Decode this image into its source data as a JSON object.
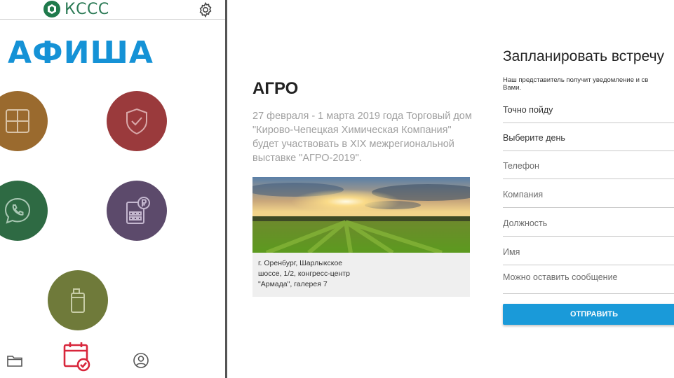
{
  "app": {
    "logo_text": "КССС",
    "section_title": "АФИША"
  },
  "tiles": [
    {
      "icon": "grid-icon",
      "color": "#9a6a2e"
    },
    {
      "icon": "shield-check-icon",
      "color": "#9a3a3c"
    },
    {
      "icon": "phone-chat-icon",
      "color": "#2e6a43"
    },
    {
      "icon": "calculator-ruble-icon",
      "color": "#5c4a6b"
    },
    {
      "icon": "canister-icon",
      "color": "#6f7a3a"
    }
  ],
  "bottom_nav": [
    {
      "icon": "folder-icon"
    },
    {
      "icon": "calendar-check-icon",
      "color": "#d8263b"
    },
    {
      "icon": "profile-icon"
    }
  ],
  "event": {
    "title": "АГРО",
    "description": "27 февраля - 1 марта 2019 года Торговый дом \"Кирово-Чепецкая Химическая Компания\" будет участвовать в XIX межрегиональной выставке \"АГРО-2019\".",
    "caption_line1": "г. Оренбург, Шарлыкское",
    "caption_line2": "шоссе, 1/2, конгресс-центр",
    "caption_line3": "\"Армада\", галерея 7"
  },
  "form": {
    "title": "Запланировать встречу",
    "note_line1": "Наш представитель получит уведомление и св",
    "note_line2": "Вами.",
    "fields": [
      {
        "label": "Точно пойду"
      },
      {
        "label": "Выберите день"
      },
      {
        "label": "Телефон"
      },
      {
        "label": "Компания"
      },
      {
        "label": "Должность"
      },
      {
        "label": "Имя"
      },
      {
        "label": "Можно оставить сообщение"
      }
    ],
    "submit_label": "ОТПРАВИТЬ"
  },
  "colors": {
    "accent": "#1592d6",
    "button": "#1a9ad9",
    "calendar": "#d8263b"
  }
}
